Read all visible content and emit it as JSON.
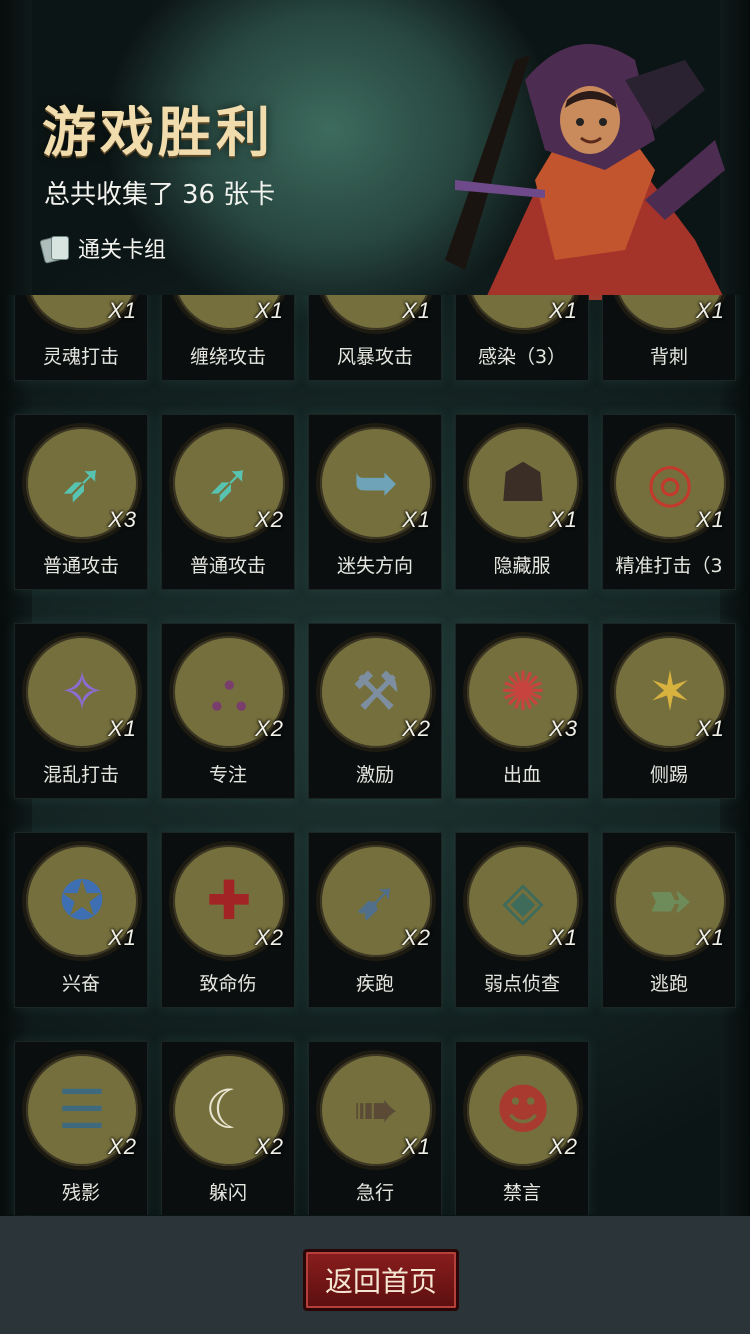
{
  "header": {
    "title": "游戏胜利",
    "summary_prefix": "总共收集了",
    "card_count": "36",
    "summary_suffix": "张卡",
    "deck_button_label": "通关卡组"
  },
  "cards": [
    {
      "name": "灵魂打击",
      "qty": "X1",
      "icon": "ice-shard-icon",
      "glyph": "❄",
      "color": "#bfe6f4"
    },
    {
      "name": "缠绕攻击",
      "qty": "X1",
      "icon": "vine-icon",
      "glyph": "❦",
      "color": "#5d7a35"
    },
    {
      "name": "风暴攻击",
      "qty": "X1",
      "icon": "lightning-icon",
      "glyph": "⚡",
      "color": "#9fd6f5"
    },
    {
      "name": "感染（3）",
      "qty": "X1",
      "icon": "infection-icon",
      "glyph": "✹",
      "color": "#c04a2e"
    },
    {
      "name": "背刺",
      "qty": "X1",
      "icon": "backstab-icon",
      "glyph": "✦",
      "color": "#9ed5c3"
    },
    {
      "name": "普通攻击",
      "qty": "X3",
      "icon": "spear-icon",
      "glyph": "➶",
      "color": "#58c3b0"
    },
    {
      "name": "普通攻击",
      "qty": "X2",
      "icon": "spear-icon",
      "glyph": "➶",
      "color": "#58c3b0"
    },
    {
      "name": "迷失方向",
      "qty": "X1",
      "icon": "signpost-icon",
      "glyph": "➥",
      "color": "#6ea3b8"
    },
    {
      "name": "隐藏服",
      "qty": "X1",
      "icon": "hooded-cloak-icon",
      "glyph": "☗",
      "color": "#3a2e26"
    },
    {
      "name": "精准打击（3",
      "qty": "X1",
      "icon": "target-icon",
      "glyph": "◎",
      "color": "#c23a2c"
    },
    {
      "name": "混乱打击",
      "qty": "X1",
      "icon": "chaos-blade-icon",
      "glyph": "✧",
      "color": "#8c6cd3"
    },
    {
      "name": "专注",
      "qty": "X2",
      "icon": "wizard-icon",
      "glyph": "⛬",
      "color": "#7a3e6c"
    },
    {
      "name": "激励",
      "qty": "X2",
      "icon": "hammer-icon",
      "glyph": "⚒",
      "color": "#7c8ea0"
    },
    {
      "name": "出血",
      "qty": "X3",
      "icon": "blood-beast-icon",
      "glyph": "✺",
      "color": "#c7433e"
    },
    {
      "name": "侧踢",
      "qty": "X1",
      "icon": "kick-icon",
      "glyph": "✶",
      "color": "#d7b23e"
    },
    {
      "name": "兴奋",
      "qty": "X1",
      "icon": "excited-dwarf-icon",
      "glyph": "✪",
      "color": "#3e6fb2"
    },
    {
      "name": "致命伤",
      "qty": "X2",
      "icon": "wound-icon",
      "glyph": "✚",
      "color": "#a32424"
    },
    {
      "name": "疾跑",
      "qty": "X2",
      "icon": "running-beast-icon",
      "glyph": "➹",
      "color": "#4f6f8a"
    },
    {
      "name": "弱点侦查",
      "qty": "X1",
      "icon": "wolf-icon",
      "glyph": "◈",
      "color": "#3f6b5a"
    },
    {
      "name": "逃跑",
      "qty": "X1",
      "icon": "fleeing-man-icon",
      "glyph": "➽",
      "color": "#6e8c5a"
    },
    {
      "name": "残影",
      "qty": "X2",
      "icon": "afterimage-icon",
      "glyph": "☰",
      "color": "#3f6a7d"
    },
    {
      "name": "躲闪",
      "qty": "X2",
      "icon": "dodge-icon",
      "glyph": "☾",
      "color": "#e8e4d0"
    },
    {
      "name": "急行",
      "qty": "X1",
      "icon": "rush-warrior-icon",
      "glyph": "➠",
      "color": "#5a4a36"
    },
    {
      "name": "禁言",
      "qty": "X2",
      "icon": "red-hood-icon",
      "glyph": "☻",
      "color": "#a83a30"
    }
  ],
  "footer": {
    "return_button_label": "返回首页"
  }
}
